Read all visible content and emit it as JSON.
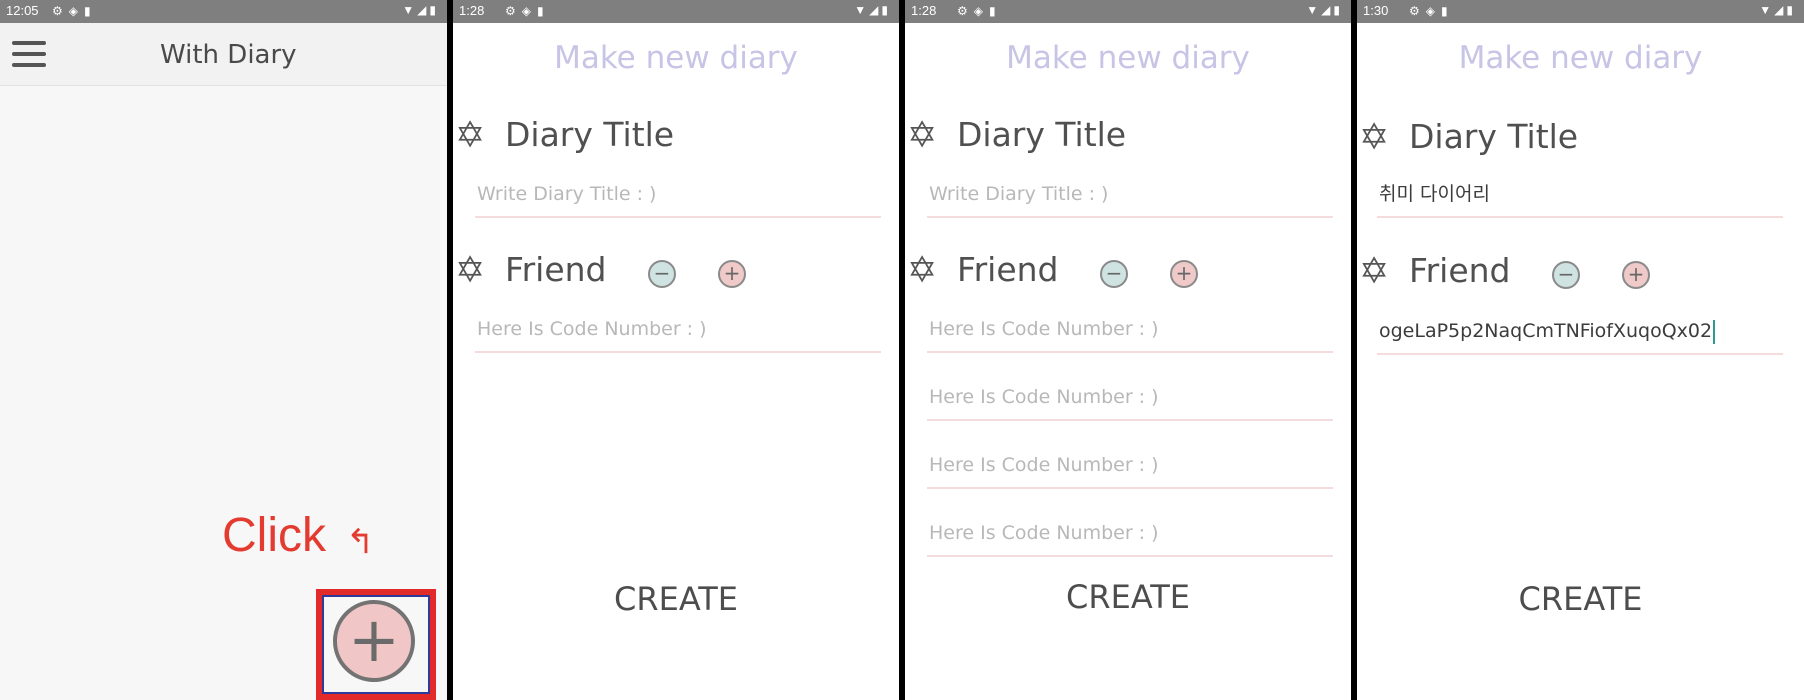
{
  "panels": [
    {
      "status_time": "12:05",
      "title": "With Diary",
      "annotation": "Click"
    },
    {
      "status_time": "1:28",
      "header": "Make new diary",
      "title_section": "Diary Title",
      "title_placeholder": "Write Diary Title : )",
      "friend_section": "Friend",
      "friend_placeholder": "Here Is Code Number : )",
      "create_label": "CREATE"
    },
    {
      "status_time": "1:28",
      "header": "Make new diary",
      "title_section": "Diary Title",
      "title_placeholder": "Write Diary Title : )",
      "friend_section": "Friend",
      "friend_placeholders": [
        "Here Is Code Number : )",
        "Here Is Code Number : )",
        "Here Is Code Number : )",
        "Here Is Code Number : )"
      ],
      "create_label": "CREATE"
    },
    {
      "status_time": "1:30",
      "header": "Make new diary",
      "title_section": "Diary Title",
      "title_value": "취미 다이어리",
      "friend_section": "Friend",
      "friend_value": "ogeLaP5p2NaqCmTNFiofXuqoQx02",
      "create_label": "CREATE"
    }
  ],
  "icons": {
    "menu": "hamburger-icon",
    "add_fab": "plus-icon",
    "section": "star-icon",
    "remove_friend": "minus-icon",
    "add_friend": "plus-icon"
  },
  "colors": {
    "header_lavender": "#c7c4e6",
    "annotation_red": "#e43b30",
    "fab_pink": "#f1c6c6",
    "minus_teal": "#cfe3e2",
    "underline_pink": "#f5dcdc"
  }
}
